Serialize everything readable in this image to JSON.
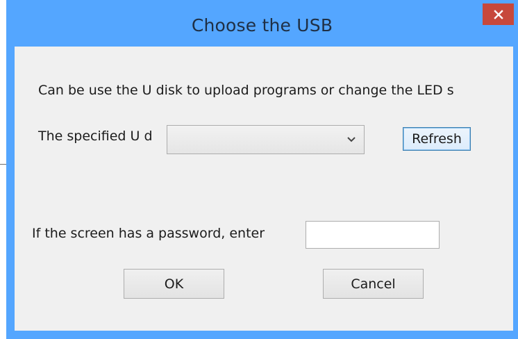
{
  "window": {
    "title": "Choose the USB",
    "close_icon": "close-icon"
  },
  "content": {
    "description": "Can be use the U disk to upload programs or change the LED s",
    "specified_label": "The specified U d",
    "usb_select": {
      "selected": "",
      "icon": "chevron-down-icon"
    },
    "refresh_label": "Refresh",
    "password_label": "If the screen has a password, enter",
    "password_value": "",
    "ok_label": "OK",
    "cancel_label": "Cancel"
  },
  "colors": {
    "titlebar": "#54a6ff",
    "close_button": "#c7483b",
    "client_background": "#f0f0f0"
  }
}
